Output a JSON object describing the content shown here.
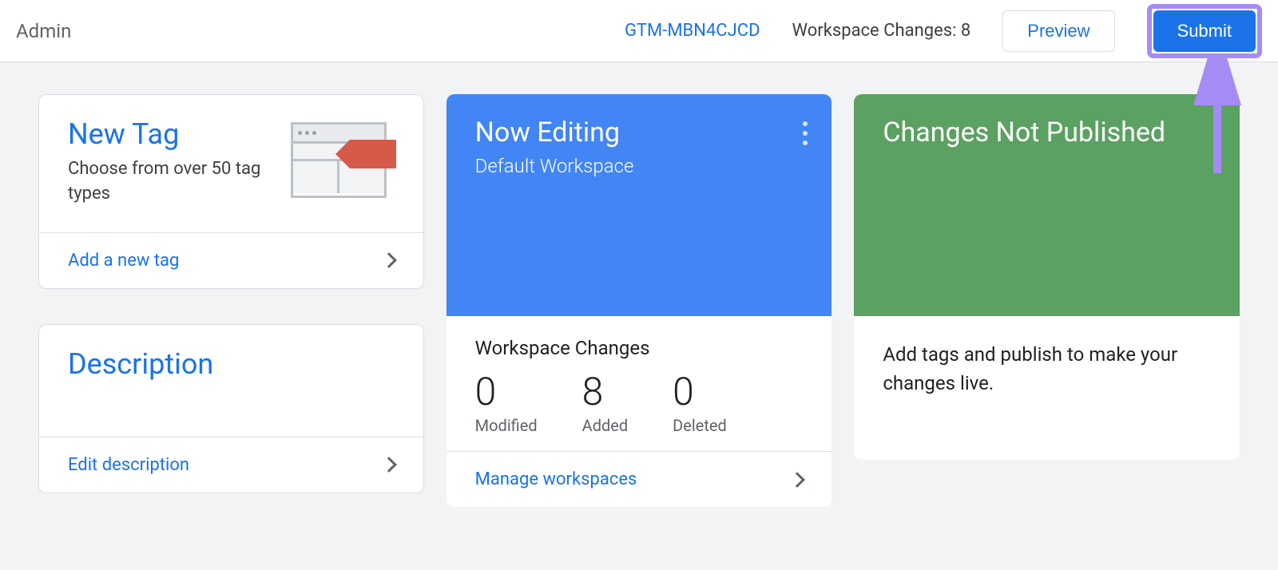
{
  "header": {
    "admin_label": "Admin",
    "container_id": "GTM-MBN4CJCD",
    "workspace_changes_label": "Workspace Changes: 8",
    "preview_label": "Preview",
    "submit_label": "Submit"
  },
  "new_tag": {
    "title": "New Tag",
    "subtitle": "Choose from over 50 tag types",
    "footer_link": "Add a new tag"
  },
  "description": {
    "title": "Description",
    "footer_link": "Edit description"
  },
  "editing": {
    "title": "Now Editing",
    "workspace_name": "Default Workspace",
    "changes_label": "Workspace Changes",
    "stats": {
      "modified_count": "0",
      "modified_label": "Modified",
      "added_count": "8",
      "added_label": "Added",
      "deleted_count": "0",
      "deleted_label": "Deleted"
    },
    "footer_link": "Manage workspaces"
  },
  "publish": {
    "title": "Changes Not Published",
    "body": "Add tags and publish to make your changes live."
  }
}
